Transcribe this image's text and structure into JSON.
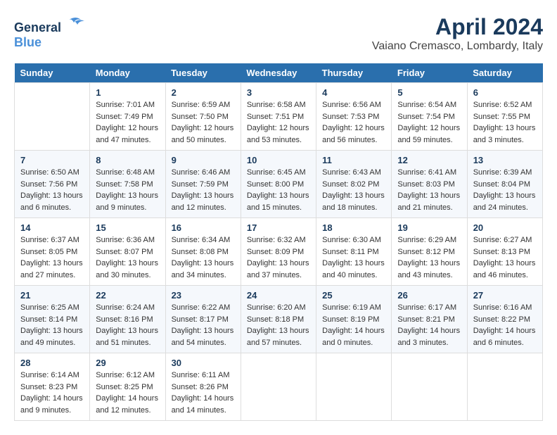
{
  "header": {
    "logo_general": "General",
    "logo_blue": "Blue",
    "title": "April 2024",
    "subtitle": "Vaiano Cremasco, Lombardy, Italy"
  },
  "calendar": {
    "days_of_week": [
      "Sunday",
      "Monday",
      "Tuesday",
      "Wednesday",
      "Thursday",
      "Friday",
      "Saturday"
    ],
    "weeks": [
      [
        {
          "day": "",
          "sunrise": "",
          "sunset": "",
          "daylight": ""
        },
        {
          "day": "1",
          "sunrise": "Sunrise: 7:01 AM",
          "sunset": "Sunset: 7:49 PM",
          "daylight": "Daylight: 12 hours and 47 minutes."
        },
        {
          "day": "2",
          "sunrise": "Sunrise: 6:59 AM",
          "sunset": "Sunset: 7:50 PM",
          "daylight": "Daylight: 12 hours and 50 minutes."
        },
        {
          "day": "3",
          "sunrise": "Sunrise: 6:58 AM",
          "sunset": "Sunset: 7:51 PM",
          "daylight": "Daylight: 12 hours and 53 minutes."
        },
        {
          "day": "4",
          "sunrise": "Sunrise: 6:56 AM",
          "sunset": "Sunset: 7:53 PM",
          "daylight": "Daylight: 12 hours and 56 minutes."
        },
        {
          "day": "5",
          "sunrise": "Sunrise: 6:54 AM",
          "sunset": "Sunset: 7:54 PM",
          "daylight": "Daylight: 12 hours and 59 minutes."
        },
        {
          "day": "6",
          "sunrise": "Sunrise: 6:52 AM",
          "sunset": "Sunset: 7:55 PM",
          "daylight": "Daylight: 13 hours and 3 minutes."
        }
      ],
      [
        {
          "day": "7",
          "sunrise": "Sunrise: 6:50 AM",
          "sunset": "Sunset: 7:56 PM",
          "daylight": "Daylight: 13 hours and 6 minutes."
        },
        {
          "day": "8",
          "sunrise": "Sunrise: 6:48 AM",
          "sunset": "Sunset: 7:58 PM",
          "daylight": "Daylight: 13 hours and 9 minutes."
        },
        {
          "day": "9",
          "sunrise": "Sunrise: 6:46 AM",
          "sunset": "Sunset: 7:59 PM",
          "daylight": "Daylight: 13 hours and 12 minutes."
        },
        {
          "day": "10",
          "sunrise": "Sunrise: 6:45 AM",
          "sunset": "Sunset: 8:00 PM",
          "daylight": "Daylight: 13 hours and 15 minutes."
        },
        {
          "day": "11",
          "sunrise": "Sunrise: 6:43 AM",
          "sunset": "Sunset: 8:02 PM",
          "daylight": "Daylight: 13 hours and 18 minutes."
        },
        {
          "day": "12",
          "sunrise": "Sunrise: 6:41 AM",
          "sunset": "Sunset: 8:03 PM",
          "daylight": "Daylight: 13 hours and 21 minutes."
        },
        {
          "day": "13",
          "sunrise": "Sunrise: 6:39 AM",
          "sunset": "Sunset: 8:04 PM",
          "daylight": "Daylight: 13 hours and 24 minutes."
        }
      ],
      [
        {
          "day": "14",
          "sunrise": "Sunrise: 6:37 AM",
          "sunset": "Sunset: 8:05 PM",
          "daylight": "Daylight: 13 hours and 27 minutes."
        },
        {
          "day": "15",
          "sunrise": "Sunrise: 6:36 AM",
          "sunset": "Sunset: 8:07 PM",
          "daylight": "Daylight: 13 hours and 30 minutes."
        },
        {
          "day": "16",
          "sunrise": "Sunrise: 6:34 AM",
          "sunset": "Sunset: 8:08 PM",
          "daylight": "Daylight: 13 hours and 34 minutes."
        },
        {
          "day": "17",
          "sunrise": "Sunrise: 6:32 AM",
          "sunset": "Sunset: 8:09 PM",
          "daylight": "Daylight: 13 hours and 37 minutes."
        },
        {
          "day": "18",
          "sunrise": "Sunrise: 6:30 AM",
          "sunset": "Sunset: 8:11 PM",
          "daylight": "Daylight: 13 hours and 40 minutes."
        },
        {
          "day": "19",
          "sunrise": "Sunrise: 6:29 AM",
          "sunset": "Sunset: 8:12 PM",
          "daylight": "Daylight: 13 hours and 43 minutes."
        },
        {
          "day": "20",
          "sunrise": "Sunrise: 6:27 AM",
          "sunset": "Sunset: 8:13 PM",
          "daylight": "Daylight: 13 hours and 46 minutes."
        }
      ],
      [
        {
          "day": "21",
          "sunrise": "Sunrise: 6:25 AM",
          "sunset": "Sunset: 8:14 PM",
          "daylight": "Daylight: 13 hours and 49 minutes."
        },
        {
          "day": "22",
          "sunrise": "Sunrise: 6:24 AM",
          "sunset": "Sunset: 8:16 PM",
          "daylight": "Daylight: 13 hours and 51 minutes."
        },
        {
          "day": "23",
          "sunrise": "Sunrise: 6:22 AM",
          "sunset": "Sunset: 8:17 PM",
          "daylight": "Daylight: 13 hours and 54 minutes."
        },
        {
          "day": "24",
          "sunrise": "Sunrise: 6:20 AM",
          "sunset": "Sunset: 8:18 PM",
          "daylight": "Daylight: 13 hours and 57 minutes."
        },
        {
          "day": "25",
          "sunrise": "Sunrise: 6:19 AM",
          "sunset": "Sunset: 8:19 PM",
          "daylight": "Daylight: 14 hours and 0 minutes."
        },
        {
          "day": "26",
          "sunrise": "Sunrise: 6:17 AM",
          "sunset": "Sunset: 8:21 PM",
          "daylight": "Daylight: 14 hours and 3 minutes."
        },
        {
          "day": "27",
          "sunrise": "Sunrise: 6:16 AM",
          "sunset": "Sunset: 8:22 PM",
          "daylight": "Daylight: 14 hours and 6 minutes."
        }
      ],
      [
        {
          "day": "28",
          "sunrise": "Sunrise: 6:14 AM",
          "sunset": "Sunset: 8:23 PM",
          "daylight": "Daylight: 14 hours and 9 minutes."
        },
        {
          "day": "29",
          "sunrise": "Sunrise: 6:12 AM",
          "sunset": "Sunset: 8:25 PM",
          "daylight": "Daylight: 14 hours and 12 minutes."
        },
        {
          "day": "30",
          "sunrise": "Sunrise: 6:11 AM",
          "sunset": "Sunset: 8:26 PM",
          "daylight": "Daylight: 14 hours and 14 minutes."
        },
        {
          "day": "",
          "sunrise": "",
          "sunset": "",
          "daylight": ""
        },
        {
          "day": "",
          "sunrise": "",
          "sunset": "",
          "daylight": ""
        },
        {
          "day": "",
          "sunrise": "",
          "sunset": "",
          "daylight": ""
        },
        {
          "day": "",
          "sunrise": "",
          "sunset": "",
          "daylight": ""
        }
      ]
    ]
  }
}
